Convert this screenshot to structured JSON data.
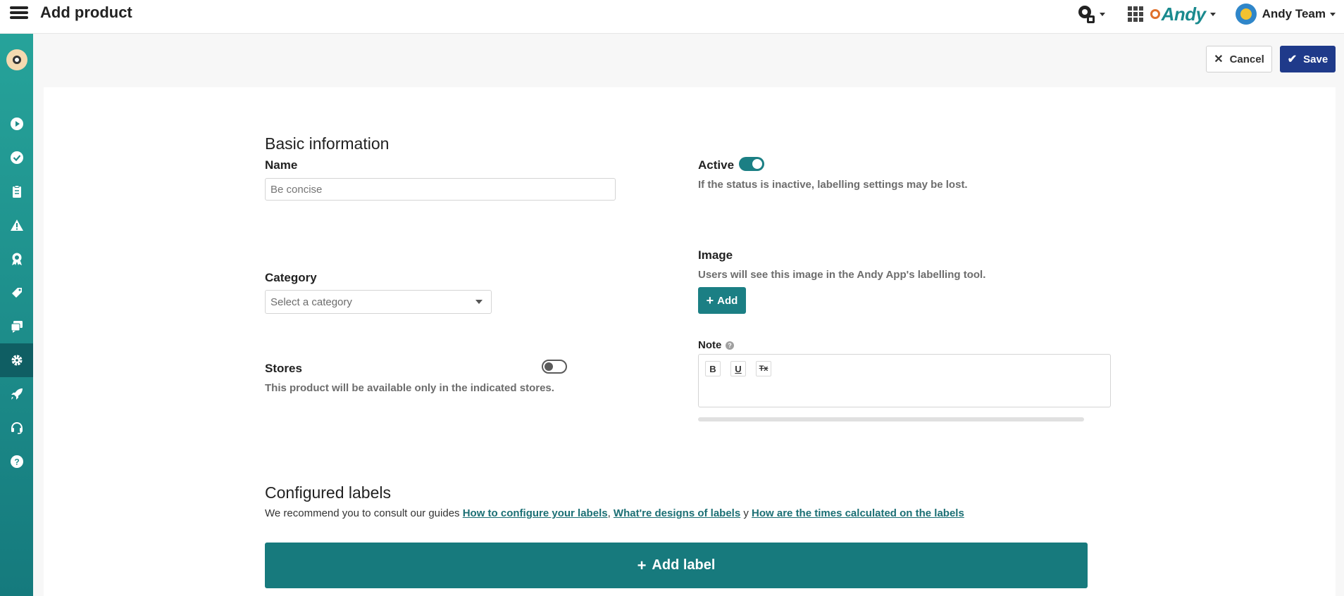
{
  "header": {
    "title": "Add product",
    "brand": "Andy",
    "team_name": "Andy Team"
  },
  "sidebar": {
    "items": [
      {
        "icon": "play-icon"
      },
      {
        "icon": "check-icon"
      },
      {
        "icon": "clipboard-icon"
      },
      {
        "icon": "warning-icon"
      },
      {
        "icon": "award-icon"
      },
      {
        "icon": "tag-icon"
      },
      {
        "icon": "chat-icon"
      },
      {
        "icon": "gear-icon",
        "active": true
      },
      {
        "icon": "rocket-icon"
      },
      {
        "icon": "headset-icon"
      },
      {
        "icon": "help-icon"
      }
    ]
  },
  "actions": {
    "cancel_label": "Cancel",
    "save_label": "Save"
  },
  "basic_info": {
    "heading": "Basic information",
    "name_label": "Name",
    "name_placeholder": "Be concise",
    "name_value": "",
    "active_label": "Active",
    "active_on": true,
    "active_help": "If the status is inactive, labelling settings may be lost.",
    "category_label": "Category",
    "category_placeholder": "Select a category",
    "image_label": "Image",
    "image_help": "Users will see this image in the Andy App's labelling tool.",
    "image_add_label": "Add",
    "stores_label": "Stores",
    "stores_on": false,
    "stores_help": "This product will be available only in the indicated stores.",
    "note_label": "Note",
    "note_help_icon": "?",
    "editor_buttons": [
      "B",
      "U",
      "Tx"
    ]
  },
  "labels_section": {
    "heading": "Configured labels",
    "intro": "We recommend you to consult our guides",
    "link1": "How to configure your labels",
    "sep1": ",",
    "link2": "What're designs of labels",
    "sep2": "y",
    "link3": "How are the times calculated on the labels",
    "add_label": "Add label"
  },
  "colors": {
    "teal": "#1b7f84",
    "navy": "#1f3a8a",
    "sidebar_top": "#26a39a",
    "sidebar_bottom": "#157a7d"
  }
}
